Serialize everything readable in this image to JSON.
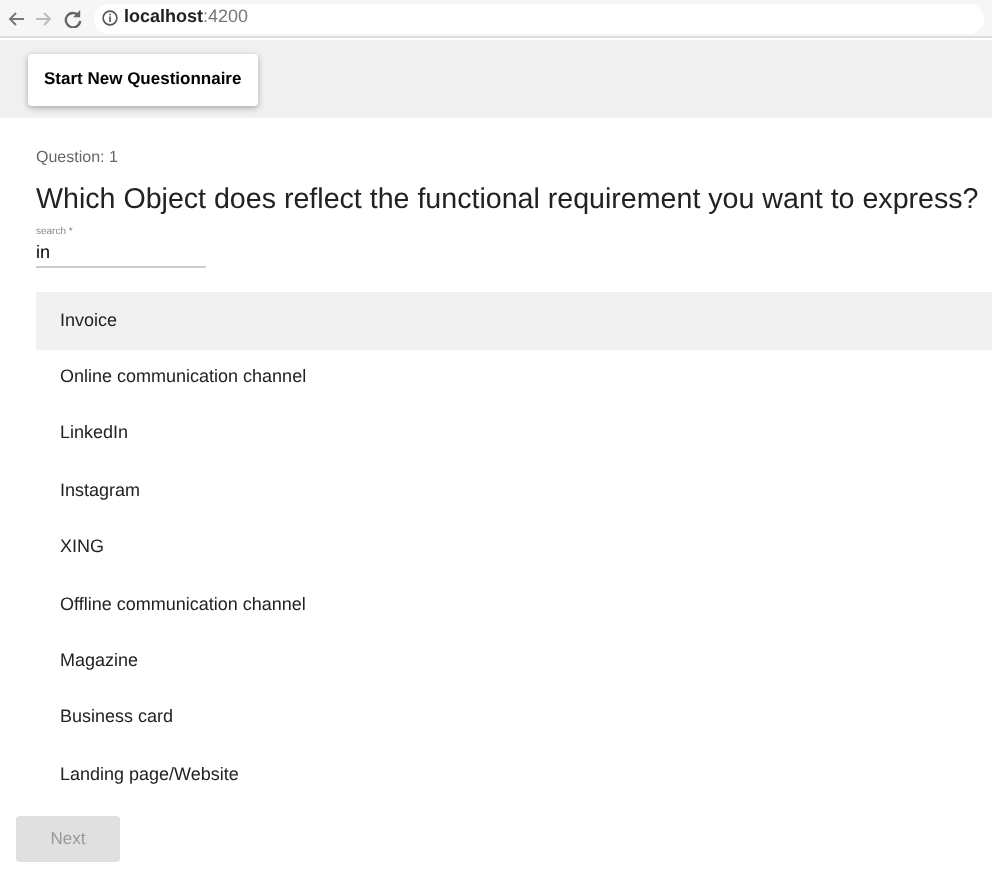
{
  "browser": {
    "url": "**localhost**:4200"
  },
  "toolbar": {
    "button": "Start New Questionnaire"
  },
  "question": {
    "label": "Question: 1",
    "title": "Which Object does reflect the functional requirement you want to express?"
  },
  "search": {
    "label": "search *",
    "value": "in"
  },
  "options": [
    {
      "label": "Invoice",
      "selected": true
    },
    {
      "label": "Online communication channel",
      "selected": false
    },
    {
      "label": "LinkedIn",
      "selected": false
    },
    {
      "label": "Instagram",
      "selected": false
    },
    {
      "label": "XING",
      "selected": false
    },
    {
      "label": "Offline communication channel",
      "selected": false
    },
    {
      "label": "Magazine",
      "selected": false
    },
    {
      "label": "Business card",
      "selected": false
    },
    {
      "label": "Landing page/Website",
      "selected": false
    }
  ],
  "next_button": {
    "label": "Next",
    "disabled": true
  }
}
